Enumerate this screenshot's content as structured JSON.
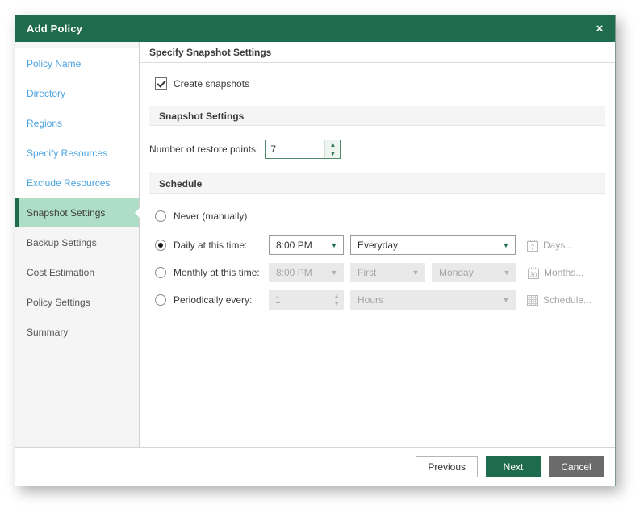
{
  "window": {
    "title": "Add Policy",
    "close_icon": "close-icon",
    "close_glyph": "×",
    "accent_green": "#1f6b4d",
    "active_item_bg": "#aedfc6"
  },
  "sidebar": {
    "items": [
      {
        "label": "Policy Name",
        "state": "visited"
      },
      {
        "label": "Directory",
        "state": "visited"
      },
      {
        "label": "Regions",
        "state": "visited"
      },
      {
        "label": "Specify Resources",
        "state": "visited"
      },
      {
        "label": "Exclude Resources",
        "state": "visited"
      },
      {
        "label": "Snapshot Settings",
        "state": "active"
      },
      {
        "label": "Backup Settings",
        "state": "pending"
      },
      {
        "label": "Cost Estimation",
        "state": "pending"
      },
      {
        "label": "Policy Settings",
        "state": "pending"
      },
      {
        "label": "Summary",
        "state": "pending"
      }
    ]
  },
  "content": {
    "header": "Specify Snapshot Settings",
    "create_snapshots": {
      "label": "Create snapshots",
      "checked": true
    },
    "snapshot_section": {
      "title": "Snapshot Settings",
      "restore_points_label": "Number of restore points:",
      "restore_points_value": "7",
      "spin_up_glyph": "▲",
      "spin_down_glyph": "▼"
    },
    "schedule_section": {
      "title": "Schedule",
      "chevron_glyph": "▼",
      "rows": [
        {
          "id": "never",
          "label": "Never (manually)",
          "selected": false,
          "enabled": true
        },
        {
          "id": "daily",
          "label": "Daily at this time:",
          "selected": true,
          "enabled": true,
          "time_value": "8:00 PM",
          "recurrence_value": "Everyday",
          "action_label": "Days...",
          "action_icon": "calendar-7-icon",
          "action_icon_text": "7"
        },
        {
          "id": "monthly",
          "label": "Monthly at this time:",
          "selected": false,
          "enabled": false,
          "time_value": "8:00 PM",
          "ordinal_value": "First",
          "weekday_value": "Monday",
          "action_label": "Months...",
          "action_icon": "calendar-30-icon",
          "action_icon_text": "30"
        },
        {
          "id": "periodically",
          "label": "Periodically every:",
          "selected": false,
          "enabled": false,
          "interval_value": "1",
          "unit_value": "Hours",
          "action_label": "Schedule...",
          "action_icon": "grid-schedule-icon"
        }
      ]
    }
  },
  "footer": {
    "previous": "Previous",
    "next": "Next",
    "cancel": "Cancel"
  }
}
